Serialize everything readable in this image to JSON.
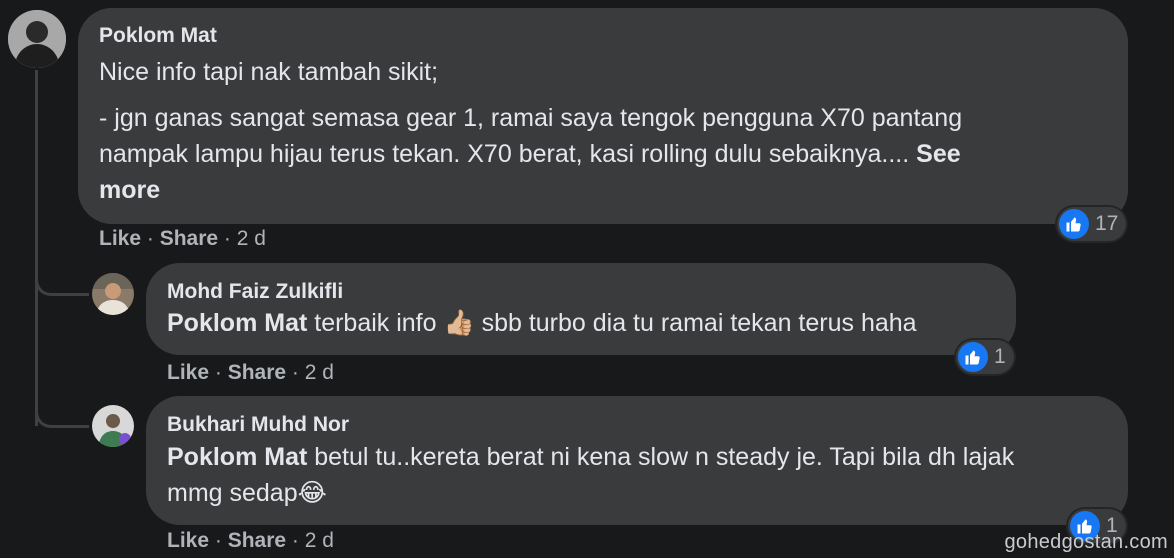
{
  "comments": [
    {
      "author": "Poklom Mat",
      "line1": "Nice info tapi nak tambah sikit;",
      "line2": "- jgn ganas sangat semasa gear 1, ramai saya tengok pengguna X70 pantang",
      "line3_text": "nampak lampu hijau terus tekan. X70 berat, kasi rolling dulu sebaiknya.... ",
      "line3_see": "See",
      "line4_see": "more",
      "actions": {
        "like": "Like",
        "sep1": " · ",
        "share": "Share",
        "sep2": " · ",
        "time": "2 d"
      },
      "reaction_count": "17"
    },
    {
      "author": "Mohd Faiz Zulkifli",
      "mention": "Poklom Mat",
      "text_a": " terbaik info ",
      "emoji": "👍🏼",
      "text_b": " sbb turbo dia tu ramai tekan terus haha",
      "actions": {
        "like": "Like",
        "sep1": " · ",
        "share": "Share",
        "sep2": " · ",
        "time": "2 d"
      },
      "reaction_count": "1"
    },
    {
      "author": "Bukhari Muhd Nor",
      "mention": "Poklom Mat",
      "line1_text": " betul tu..kereta berat ni kena slow n steady je. Tapi bila dh lajak",
      "line2_text": "mmg sedap",
      "emoji": "😂",
      "actions": {
        "like": "Like",
        "sep1": " · ",
        "share": "Share",
        "sep2": " · ",
        "time": "2 d"
      },
      "reaction_count": "1"
    }
  ],
  "watermark": "gohedgostan.com",
  "icons": {
    "reaction": "thumbs-up-icon",
    "avatar": "avatar"
  },
  "colors": {
    "background": "#18191a",
    "bubble": "#3a3b3c",
    "text": "#e4e6eb",
    "secondary": "#b0b3b8",
    "like_blue": "#1877f2"
  }
}
